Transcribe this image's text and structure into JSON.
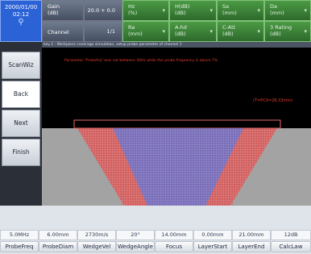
{
  "header": {
    "date": "2000/01/00",
    "time": "02:12",
    "usb_icon": "usb-icon",
    "gain_label": "Gain\n(dB)",
    "gain_value": "20.0 + 0.0",
    "channel_label": "Channel",
    "channel_value": "1/1",
    "readouts": [
      {
        "label": "Hz\n(%)"
      },
      {
        "label": "H(dB)\n(dB)"
      },
      {
        "label": "Sa\n(mm)"
      },
      {
        "label": "Da\n(mm)"
      },
      {
        "label": "Ra\n(mm)"
      },
      {
        "label": "A-hd\n(dB)"
      },
      {
        "label": "C-Att\n(dB)"
      },
      {
        "label": "3 Rating\n(dB)"
      }
    ]
  },
  "steps": {
    "buttons": [
      "ScanWiz",
      "Back",
      "Next",
      "Finish"
    ],
    "selected": "Back"
  },
  "main": {
    "message_bar": "key 2 : Workpiece coverage simulation, setup probe parameter of channel 1",
    "warning": "Parameter \"Probefrq\" was not between 30Hz while the probe frequency is above 7%",
    "focus_readout": "(T=PCS=28.33mm)"
  },
  "params": [
    {
      "value": "5.0MHz",
      "label": "ProbeFreq"
    },
    {
      "value": "6.00mm",
      "label": "ProbeDiam"
    },
    {
      "value": "2730m/s",
      "label": "WedgeVel"
    },
    {
      "value": "20°",
      "label": "WedgeAngle"
    },
    {
      "value": "14.00mm",
      "label": "Focus"
    },
    {
      "value": "0.00mm",
      "label": "LayerStart"
    },
    {
      "value": "21.00mm",
      "label": "LayerEnd"
    },
    {
      "value": "12dB",
      "label": "CalcLaw"
    }
  ],
  "colors": {
    "header_blue": "#2b62d6",
    "param_green": "#4b9a45",
    "beam_red": "#e26a6a",
    "beam_blue": "#6b72c8",
    "warning_red": "#e23a2a"
  }
}
